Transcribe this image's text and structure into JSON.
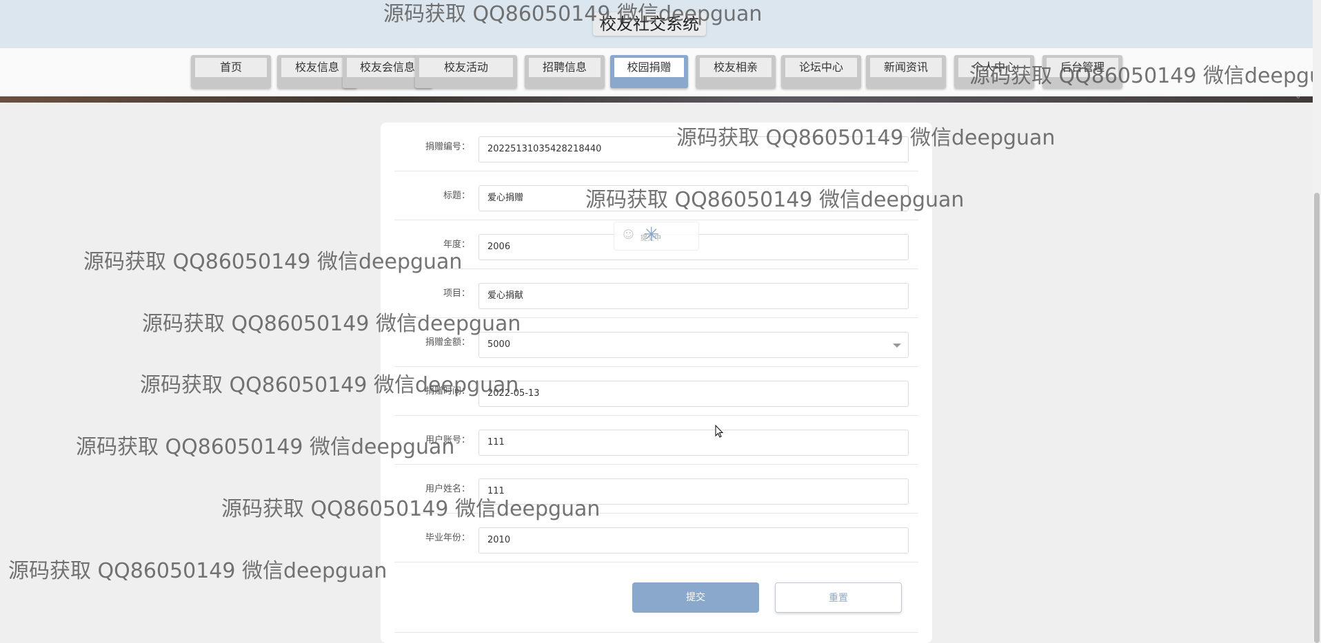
{
  "site": {
    "title": "校友社交系统"
  },
  "nav": {
    "items": [
      {
        "label": "首页",
        "active": false
      },
      {
        "label": "校友信息",
        "active": false
      },
      {
        "label": "校友会信息",
        "active": false
      },
      {
        "label": "校友活动",
        "active": false
      },
      {
        "label": "招聘信息",
        "active": false
      },
      {
        "label": "校园捐赠",
        "active": true
      },
      {
        "label": "校友相亲",
        "active": false
      },
      {
        "label": "论坛中心",
        "active": false
      },
      {
        "label": "新闻资讯",
        "active": false
      },
      {
        "label": "个人中心",
        "active": false
      },
      {
        "label": "后台管理",
        "active": false
      }
    ]
  },
  "form": {
    "fields": [
      {
        "label": "捐赠编号：",
        "value": "20225131035428218440"
      },
      {
        "label": "标题：",
        "value": "爱心捐赠"
      },
      {
        "label": "年度：",
        "value": "2006"
      },
      {
        "label": "项目：",
        "value": "爱心捐献"
      },
      {
        "label": "捐赠金额：",
        "value": "5000"
      },
      {
        "label": "捐赠时间：",
        "value": "2022-05-13"
      },
      {
        "label": "用户账号：",
        "value": "111"
      },
      {
        "label": "用户姓名：",
        "value": "111"
      },
      {
        "label": "毕业年份：",
        "value": "2010"
      }
    ],
    "submit_label": "提交",
    "reset_label": "重置"
  },
  "loading": {
    "text": "提交中"
  },
  "watermark": {
    "text": "源码获取 QQ86050149 微信deepguan"
  },
  "colors": {
    "accent": "#8aa8cc",
    "topbar": "#dce6ee",
    "background": "#efefef"
  }
}
